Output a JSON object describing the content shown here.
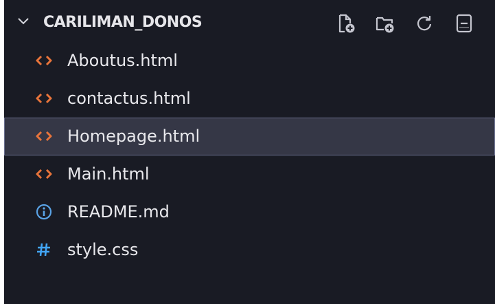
{
  "explorer": {
    "folder_name": "CARILIMAN_DONOS",
    "chevron_icon": "chevron-down-icon",
    "toolbar": [
      {
        "icon": "new-file-icon"
      },
      {
        "icon": "new-folder-icon"
      },
      {
        "icon": "refresh-icon"
      },
      {
        "icon": "collapse-all-icon"
      }
    ],
    "files": [
      {
        "name": "Aboutus.html",
        "icon": "html-icon",
        "selected": false
      },
      {
        "name": "contactus.html",
        "icon": "html-icon",
        "selected": false
      },
      {
        "name": "Homepage.html",
        "icon": "html-icon",
        "selected": true
      },
      {
        "name": "Main.html",
        "icon": "html-icon",
        "selected": false
      },
      {
        "name": "README.md",
        "icon": "info-icon",
        "selected": false
      },
      {
        "name": "style.css",
        "icon": "hash-icon",
        "selected": false
      }
    ]
  },
  "colors": {
    "background": "#191b24",
    "selection": "#353746",
    "html_icon": "#e8743b",
    "info_icon": "#5aa3e6",
    "css_icon": "#42a5f5",
    "toolbar_icon": "#c5c6cf"
  }
}
